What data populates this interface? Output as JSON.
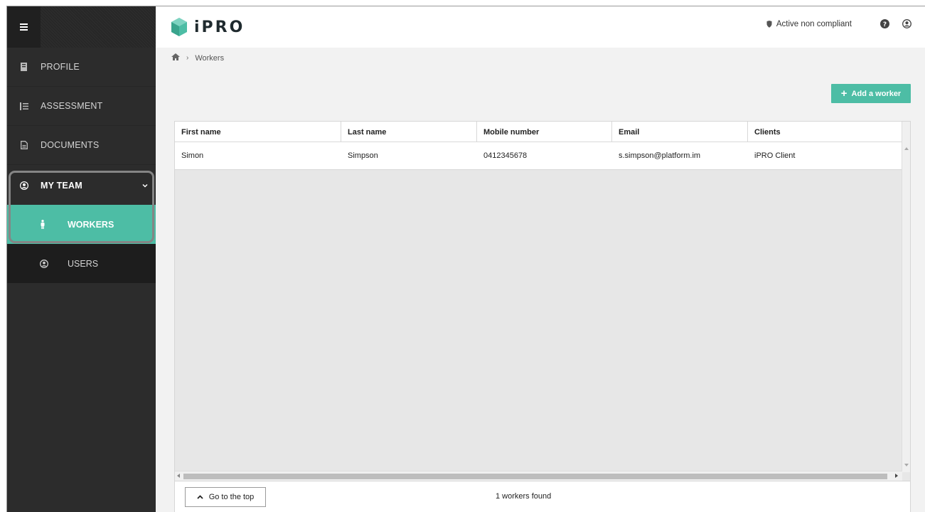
{
  "app": {
    "logo_text": "iPRO",
    "brand_color": "#4dbda5"
  },
  "header": {
    "status_label": "Active non compliant"
  },
  "sidebar": {
    "items": [
      {
        "label": "PROFILE",
        "icon": "profile-icon"
      },
      {
        "label": "ASSESSMENT",
        "icon": "list-icon"
      },
      {
        "label": "DOCUMENTS",
        "icon": "document-icon"
      },
      {
        "label": "MY TEAM",
        "icon": "user-circle-icon",
        "expanded": true
      }
    ],
    "subitems": [
      {
        "label": "WORKERS",
        "icon": "person-icon",
        "active": true
      },
      {
        "label": "USERS",
        "icon": "user-icon",
        "active": false
      }
    ]
  },
  "breadcrumb": {
    "current": "Workers"
  },
  "actions": {
    "add_worker_label": "Add a worker"
  },
  "table": {
    "columns": [
      "First name",
      "Last name",
      "Mobile number",
      "Email",
      "Clients"
    ],
    "rows": [
      [
        "Simon",
        "Simpson",
        "0412345678",
        "s.simpson@platform.im",
        "iPRO Client"
      ]
    ]
  },
  "footer": {
    "go_top_label": "Go to the top",
    "count_text": "1 workers found"
  }
}
